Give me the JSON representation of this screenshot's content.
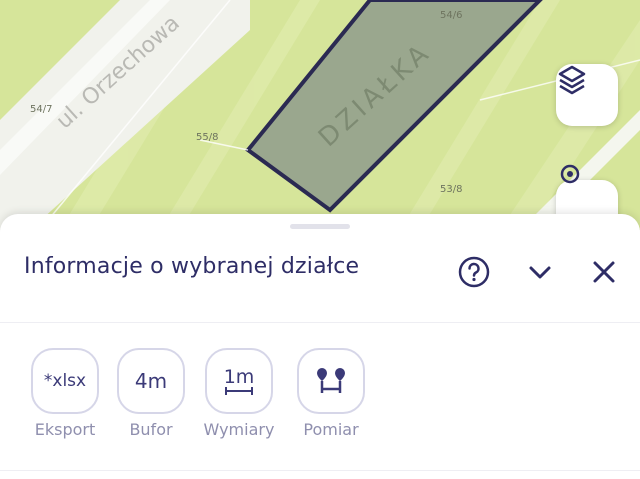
{
  "map": {
    "street_name": "ul. Orzechowa",
    "parcel_label_main": "DZIAŁKA",
    "plot_numbers": [
      "54/6",
      "54/7",
      "55/8",
      "53/8"
    ],
    "colors": {
      "land": "#d6e59a",
      "land_light": "#e3eeb3",
      "road": "#f2f2ee",
      "parcel_fill": "#9aa78e",
      "parcel_border": "#2b2a52"
    },
    "layers_icon": "layers-icon",
    "locate_icon": "locate-icon"
  },
  "sheet": {
    "title": "Informacje o wybranej działce",
    "help_icon": "help-circle-icon",
    "collapse_icon": "chevron-down-icon",
    "close_icon": "close-icon",
    "tools": [
      {
        "icon_text": "*xlsx",
        "label": "Eksport"
      },
      {
        "icon_text": "4m",
        "label": "Bufor"
      },
      {
        "icon_text": "1m",
        "label": "Wymiary"
      },
      {
        "icon_text": "",
        "label": "Pomiar"
      }
    ]
  },
  "colors": {
    "accent": "#2e2d66",
    "muted": "#8f8fae",
    "tool_border": "#d6d6e8"
  }
}
